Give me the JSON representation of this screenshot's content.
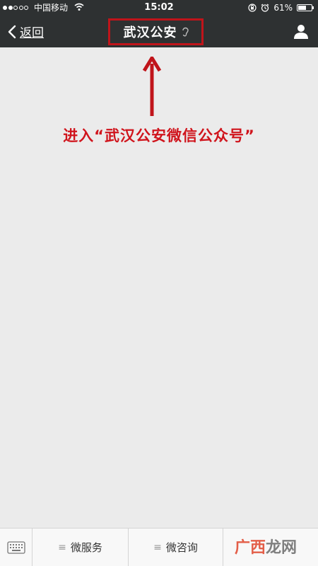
{
  "status_bar": {
    "carrier": "中国移动",
    "time": "15:02",
    "battery_percent": "61%",
    "battery_level": 0.61,
    "signal_bars_filled": 2,
    "signal_bars_total": 5
  },
  "nav": {
    "back_label": "返回",
    "title": "武汉公安"
  },
  "annotation": {
    "text": "进入“武汉公安微信公众号”",
    "color": "#d0141c"
  },
  "bottom_menu": {
    "items": [
      {
        "label": "微服务",
        "icon": "menu-lines-icon"
      },
      {
        "label": "微咨询",
        "icon": "menu-lines-icon"
      },
      {
        "label": "",
        "icon": ""
      }
    ]
  },
  "watermark": {
    "part1": "广西",
    "part2": "龙网"
  },
  "colors": {
    "nav_bg": "#2e3132",
    "content_bg": "#ebebeb",
    "highlight": "#c0141a"
  }
}
